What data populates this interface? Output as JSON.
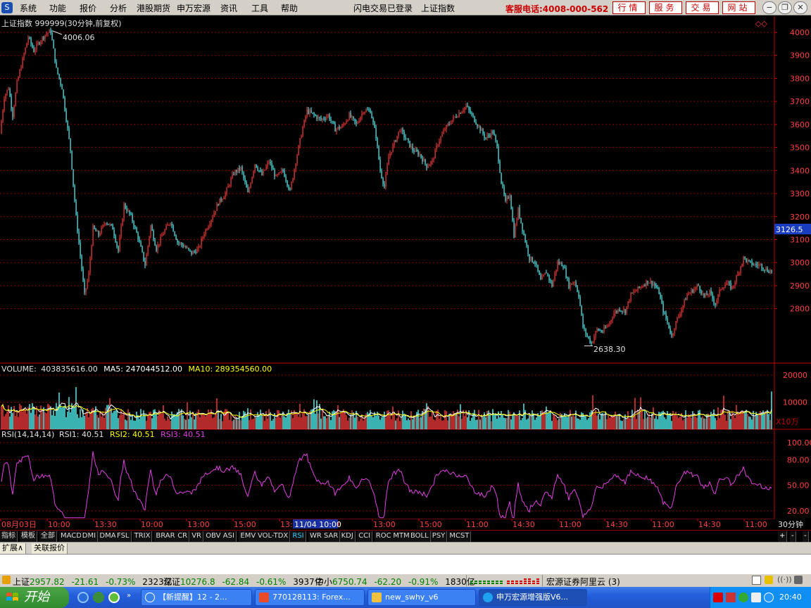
{
  "menubar": {
    "items": [
      "系统",
      "功能",
      "报价",
      "分析",
      "港股期货",
      "申万宏源",
      "资讯",
      "工具",
      "帮助"
    ],
    "center": [
      "闪电交易已登录",
      "上证指数"
    ],
    "hotline": "客服电话:4008-000-562",
    "buttons": [
      "行情",
      "服务",
      "交易",
      "网站"
    ]
  },
  "chart": {
    "title": "上证指数 999999(30分钟,前复权)",
    "high_label": "4006.06",
    "low_label": "2638.30",
    "current_price": "3126.5",
    "price_ticks": [
      "4000",
      "3900",
      "3800",
      "3700",
      "3600",
      "3500",
      "3400",
      "3300",
      "3200",
      "3100",
      "3000",
      "2900",
      "2800"
    ],
    "volume_header": {
      "name": "VOLUME:",
      "value": "403835616.00",
      "ma5": "MA5: 247044512.00",
      "ma10": "MA10: 289354560.00"
    },
    "volume_ticks": [
      "20000",
      "10000"
    ],
    "volume_unit": "X10万",
    "rsi_header": {
      "name": "RSI(14,14,14)",
      "rsi1": "RSI1: 40.51",
      "rsi2": "RSI2: 40.51",
      "rsi3": "RSI3: 40.51"
    },
    "rsi_ticks": [
      "100.00",
      "80.00",
      "50.00",
      "20.00"
    ],
    "time_labels": [
      "08月03日",
      "10:00",
      "13:30",
      "10:00",
      "13:00",
      "15:00",
      "13:",
      "00",
      "13:00",
      "15:00",
      "11:00",
      "14:30",
      "11:00",
      "14:30",
      "11:00",
      "14:30",
      "11:00"
    ],
    "cursor_time": "11/04 10:00",
    "period": "30分钟"
  },
  "chart_data": {
    "type": "candlestick",
    "title": "上证指数 999999(30分钟,前复权)",
    "ylim": [
      2600,
      4050
    ],
    "high": 4006.06,
    "low": 2638.3,
    "last": 3126.5,
    "rsi": {
      "rsi1": 40.51,
      "rsi2": 40.51,
      "rsi3": 40.51,
      "ylim": [
        10,
        100
      ]
    },
    "volume": {
      "last": 403835616.0,
      "ma5": 247044512.0,
      "ma10": 289354560.0,
      "unit": "X10万"
    },
    "path": [
      [
        0,
        3560
      ],
      [
        6,
        3720
      ],
      [
        12,
        3760
      ],
      [
        18,
        3640
      ],
      [
        24,
        3780
      ],
      [
        32,
        3880
      ],
      [
        40,
        3980
      ],
      [
        48,
        3920
      ],
      [
        56,
        3960
      ],
      [
        64,
        3990
      ],
      [
        72,
        4006
      ],
      [
        80,
        3840
      ],
      [
        88,
        3760
      ],
      [
        96,
        3580
      ],
      [
        100,
        3490
      ],
      [
        104,
        3340
      ],
      [
        108,
        3200
      ],
      [
        114,
        3030
      ],
      [
        120,
        2860
      ],
      [
        126,
        2950
      ],
      [
        132,
        3150
      ],
      [
        140,
        3120
      ],
      [
        150,
        3180
      ],
      [
        160,
        3150
      ],
      [
        168,
        3050
      ],
      [
        176,
        3250
      ],
      [
        186,
        3200
      ],
      [
        196,
        3110
      ],
      [
        206,
        2990
      ],
      [
        214,
        3160
      ],
      [
        222,
        3060
      ],
      [
        232,
        3130
      ],
      [
        242,
        3180
      ],
      [
        252,
        3090
      ],
      [
        262,
        3070
      ],
      [
        272,
        3040
      ],
      [
        282,
        3060
      ],
      [
        290,
        3130
      ],
      [
        300,
        3190
      ],
      [
        310,
        3260
      ],
      [
        320,
        3300
      ],
      [
        332,
        3390
      ],
      [
        342,
        3410
      ],
      [
        352,
        3300
      ],
      [
        362,
        3430
      ],
      [
        372,
        3380
      ],
      [
        382,
        3440
      ],
      [
        392,
        3370
      ],
      [
        402,
        3400
      ],
      [
        412,
        3310
      ],
      [
        420,
        3440
      ],
      [
        428,
        3560
      ],
      [
        436,
        3660
      ],
      [
        446,
        3640
      ],
      [
        456,
        3620
      ],
      [
        466,
        3640
      ],
      [
        476,
        3580
      ],
      [
        486,
        3590
      ],
      [
        496,
        3640
      ],
      [
        506,
        3600
      ],
      [
        516,
        3660
      ],
      [
        526,
        3660
      ],
      [
        534,
        3550
      ],
      [
        540,
        3400
      ],
      [
        546,
        3330
      ],
      [
        552,
        3460
      ],
      [
        560,
        3520
      ],
      [
        568,
        3580
      ],
      [
        576,
        3540
      ],
      [
        586,
        3490
      ],
      [
        596,
        3470
      ],
      [
        606,
        3420
      ],
      [
        614,
        3440
      ],
      [
        622,
        3520
      ],
      [
        632,
        3580
      ],
      [
        642,
        3620
      ],
      [
        652,
        3650
      ],
      [
        662,
        3680
      ],
      [
        672,
        3630
      ],
      [
        680,
        3590
      ],
      [
        690,
        3540
      ],
      [
        700,
        3570
      ],
      [
        706,
        3500
      ],
      [
        712,
        3350
      ],
      [
        718,
        3260
      ],
      [
        724,
        3300
      ],
      [
        730,
        3120
      ],
      [
        736,
        3230
      ],
      [
        744,
        3120
      ],
      [
        752,
        3020
      ],
      [
        760,
        3000
      ],
      [
        768,
        2920
      ],
      [
        776,
        2960
      ],
      [
        784,
        2900
      ],
      [
        792,
        3000
      ],
      [
        800,
        2990
      ],
      [
        808,
        2900
      ],
      [
        816,
        2920
      ],
      [
        822,
        2860
      ],
      [
        828,
        2720
      ],
      [
        834,
        2680
      ],
      [
        840,
        2650
      ],
      [
        848,
        2710
      ],
      [
        856,
        2700
      ],
      [
        864,
        2730
      ],
      [
        872,
        2780
      ],
      [
        880,
        2800
      ],
      [
        888,
        2790
      ],
      [
        896,
        2860
      ],
      [
        904,
        2880
      ],
      [
        912,
        2900
      ],
      [
        920,
        2920
      ],
      [
        928,
        2910
      ],
      [
        936,
        2870
      ],
      [
        942,
        2790
      ],
      [
        948,
        2740
      ],
      [
        954,
        2680
      ],
      [
        960,
        2740
      ],
      [
        968,
        2800
      ],
      [
        976,
        2860
      ],
      [
        984,
        2880
      ],
      [
        992,
        2900
      ],
      [
        1000,
        2850
      ],
      [
        1008,
        2870
      ],
      [
        1016,
        2820
      ],
      [
        1024,
        2890
      ],
      [
        1032,
        2910
      ],
      [
        1040,
        2890
      ],
      [
        1048,
        2950
      ],
      [
        1056,
        3020
      ],
      [
        1064,
        3000
      ],
      [
        1072,
        2990
      ],
      [
        1080,
        2990
      ],
      [
        1088,
        2970
      ],
      [
        1097,
        2960
      ]
    ]
  },
  "indicator_tabs": [
    "指标",
    "模板",
    "全部",
    "MACD",
    "DMI",
    "DMA",
    "FSL",
    "TRIX",
    "BRAR",
    "CR",
    "VR",
    "OBV",
    "ASI",
    "EMV",
    "VOL-TDX",
    "RSI",
    "WR",
    "SAR",
    "KDJ",
    "CCI",
    "ROC",
    "MTM",
    "BOLL",
    "PSY",
    "MCST"
  ],
  "active_indicator": "RSI",
  "tabs2": [
    "扩展∧",
    "关联报价"
  ],
  "statusbar": {
    "sh": {
      "name": "上证",
      "price": "2957.82",
      "chg": "-21.61",
      "pct": "-0.73%",
      "amt": "2323亿"
    },
    "sz": {
      "name": "深证",
      "price": "10276.8",
      "chg": "-62.84",
      "pct": "-0.61%",
      "amt": "3937亿"
    },
    "zx": {
      "name": "中小",
      "price": "6750.74",
      "chg": "-62.20",
      "pct": "-0.91%",
      "amt": "1830亿"
    },
    "server": "宏源证券阿里云 (3)"
  },
  "taskbar": {
    "start": "开始",
    "tasks": [
      "【新提醒】12 - 2...",
      "770128113: Forex...",
      "new_swhy_v6",
      "申万宏源增强版V6..."
    ],
    "clock": "20:40"
  },
  "colors": {
    "up": "#ff3c3c",
    "down": "#54ffff",
    "grid": "#8b0000",
    "axis": "#c00000",
    "rsi": "#e040e0",
    "ma5": "#ffffff",
    "ma10": "#ffff00"
  }
}
